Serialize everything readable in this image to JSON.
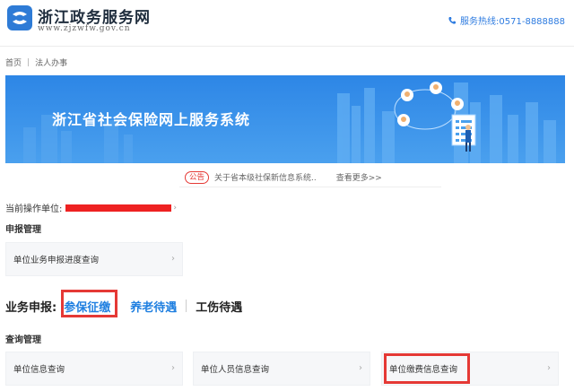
{
  "header": {
    "brand_title": "浙江政务服务网",
    "brand_url": "www.zjzwfw.gov.cn",
    "hotline": "服务热线:0571-8888888"
  },
  "breadcrumb": {
    "home": "首页",
    "current": "法人办事"
  },
  "banner": {
    "title": "浙江省社会保险网上服务系统"
  },
  "notice": {
    "badge": "公告",
    "text": "关于省本级社保新信息系统..",
    "more": "查看更多>>"
  },
  "unit": {
    "label": "当前操作单位:",
    "arrow": "›"
  },
  "declaration": {
    "section_title": "申报管理",
    "card_label": "单位业务申报进度查询"
  },
  "business": {
    "label": "业务申报:",
    "tabs": [
      "参保征缴",
      "养老待遇",
      "工伤待遇"
    ]
  },
  "query": {
    "section_title": "查询管理",
    "cards": [
      "单位信息查询",
      "单位人员信息查询",
      "单位缴费信息查询"
    ]
  },
  "colors": {
    "accent": "#1f7fe0",
    "highlight_red": "#e53935",
    "banner_blue": "#2d86e6"
  },
  "icons": {
    "logo": "zhejiang-gov-logo-icon",
    "phone": "phone-icon",
    "chevron": "chevron-right-icon"
  }
}
